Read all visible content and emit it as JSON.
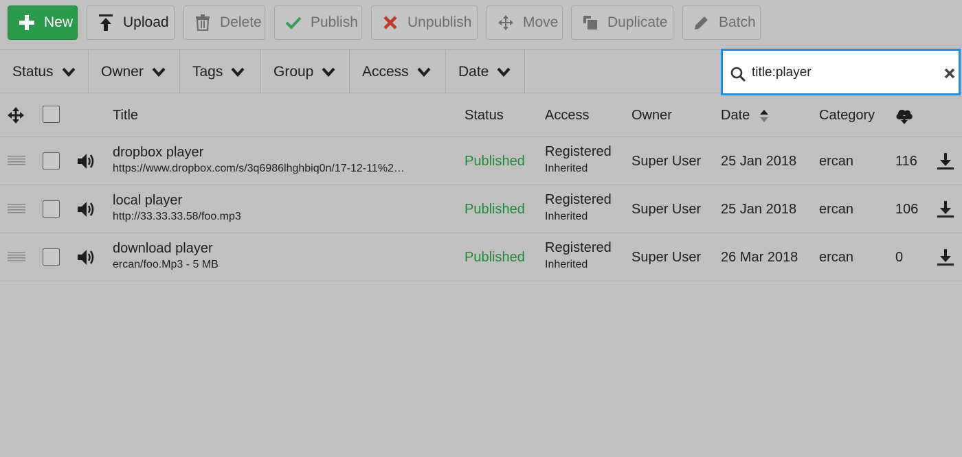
{
  "toolbar": {
    "new": "New",
    "upload": "Upload",
    "delete": "Delete",
    "publish": "Publish",
    "unpublish": "Unpublish",
    "move": "Move",
    "duplicate": "Duplicate",
    "batch": "Batch"
  },
  "filters": {
    "status": "Status",
    "owner": "Owner",
    "tags": "Tags",
    "group": "Group",
    "access": "Access",
    "date": "Date"
  },
  "search": {
    "value": "title:player"
  },
  "table": {
    "headers": {
      "title": "Title",
      "status": "Status",
      "access": "Access",
      "owner": "Owner",
      "date": "Date",
      "category": "Category"
    },
    "rows": [
      {
        "title": "dropbox player",
        "subtitle": "https://www.dropbox.com/s/3q6986lhghbiq0n/17-12-11%2…",
        "status": "Published",
        "access": "Registered",
        "access_sub": "Inherited",
        "owner": "Super User",
        "date": "25 Jan 2018",
        "category": "ercan",
        "downloads": "116"
      },
      {
        "title": "local player",
        "subtitle": "http://33.33.33.58/foo.mp3",
        "status": "Published",
        "access": "Registered",
        "access_sub": "Inherited",
        "owner": "Super User",
        "date": "25 Jan 2018",
        "category": "ercan",
        "downloads": "106"
      },
      {
        "title": "download player",
        "subtitle": "ercan/foo.Mp3 - 5 MB",
        "status": "Published",
        "access": "Registered",
        "access_sub": "Inherited",
        "owner": "Super User",
        "date": "26 Mar 2018",
        "category": "ercan",
        "downloads": "0"
      }
    ]
  },
  "colors": {
    "background": "#c0c0c0",
    "new_button": "#2a9a4a",
    "published": "#1f8a3b",
    "search_focus": "#1b8fe0",
    "publish_check": "#3a9a5a",
    "unpublish_x": "#c0392b"
  },
  "icons": {
    "new": "plus-icon",
    "upload": "upload-icon",
    "delete": "trash-icon",
    "publish": "check-icon",
    "unpublish": "x-icon",
    "move": "move-arrows-icon",
    "duplicate": "duplicate-icon",
    "batch": "pencil-icon",
    "search": "search-icon",
    "clear": "close-icon",
    "row_type": "speaker-icon",
    "row_action": "download-icon",
    "downloads_header": "cloud-download-icon"
  }
}
